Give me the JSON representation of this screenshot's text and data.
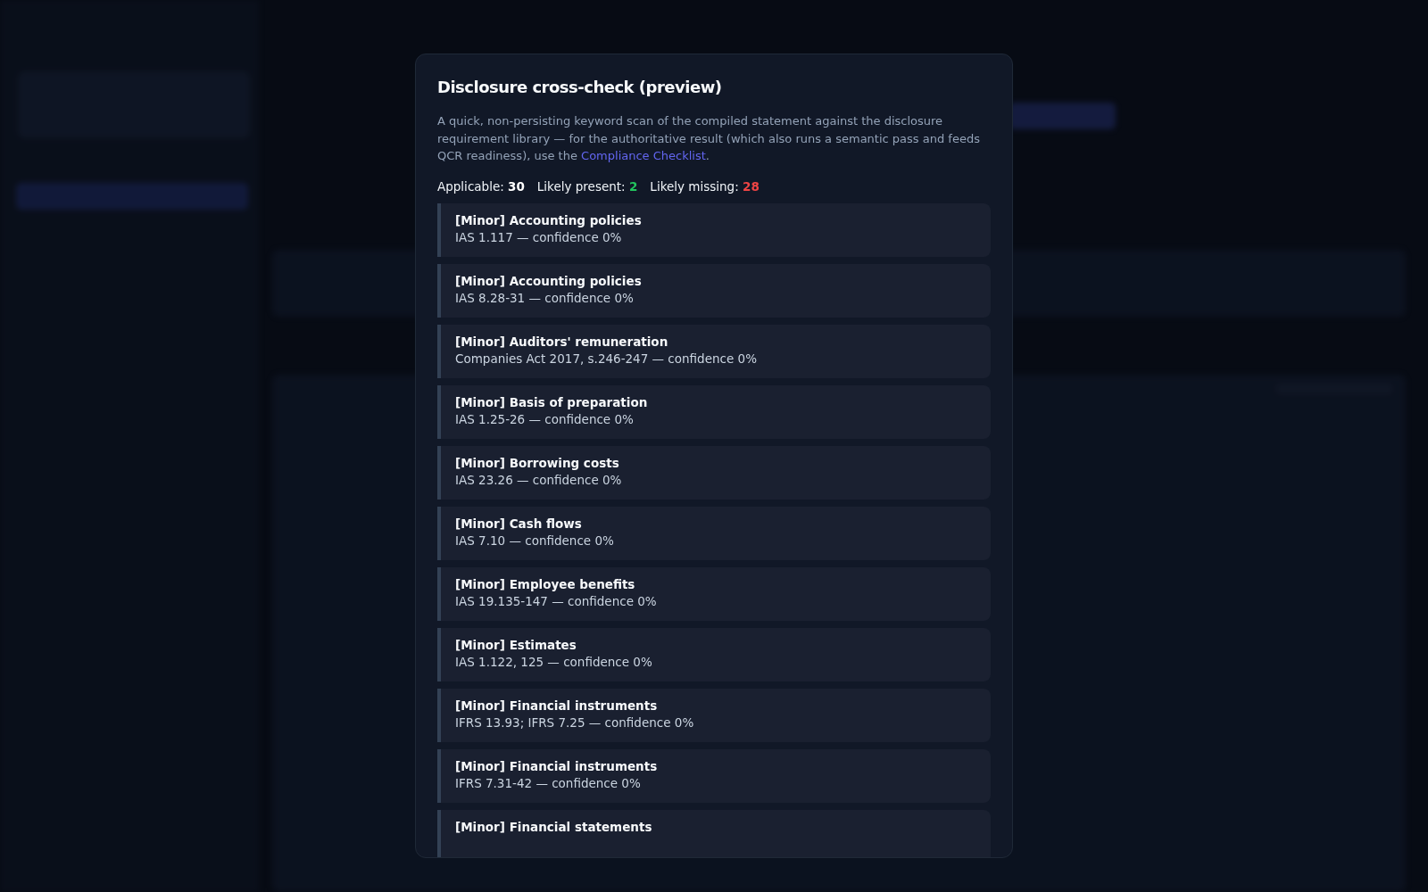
{
  "dialog": {
    "title": "Disclosure cross-check (preview)",
    "description_before": "A quick, non-persisting keyword scan of the compiled statement against the disclosure requirement library — for the authoritative result (which also runs a semantic pass and feeds QCR readiness), use the ",
    "link": "Compliance Checklist",
    "description_after": ".",
    "stats": [
      {
        "label": "Applicable:",
        "value": "30",
        "color": "#ffffff"
      },
      {
        "label": "Likely present:",
        "value": "2",
        "color": "#22c55e"
      },
      {
        "label": "Likely missing:",
        "value": "28",
        "color": "#ef4444"
      }
    ],
    "items": [
      {
        "title": "[Minor] Accounting policies",
        "detail": "IAS 1.117 — confidence 0%"
      },
      {
        "title": "[Minor] Accounting policies",
        "detail": "IAS 8.28-31 — confidence 0%"
      },
      {
        "title": "[Minor] Auditors' remuneration",
        "detail": "Companies Act 2017, s.246-247 — confidence 0%"
      },
      {
        "title": "[Minor] Basis of preparation",
        "detail": "IAS 1.25-26 — confidence 0%"
      },
      {
        "title": "[Minor] Borrowing costs",
        "detail": "IAS 23.26 — confidence 0%"
      },
      {
        "title": "[Minor] Cash flows",
        "detail": "IAS 7.10 — confidence 0%"
      },
      {
        "title": "[Minor] Employee benefits",
        "detail": "IAS 19.135-147 — confidence 0%"
      },
      {
        "title": "[Minor] Estimates",
        "detail": "IAS 1.122, 125 — confidence 0%"
      },
      {
        "title": "[Minor] Financial instruments",
        "detail": "IFRS 13.93; IFRS 7.25 — confidence 0%"
      },
      {
        "title": "[Minor] Financial instruments",
        "detail": "IFRS 7.31-42 — confidence 0%"
      },
      {
        "title": "[Minor] Financial statements"
      }
    ]
  }
}
